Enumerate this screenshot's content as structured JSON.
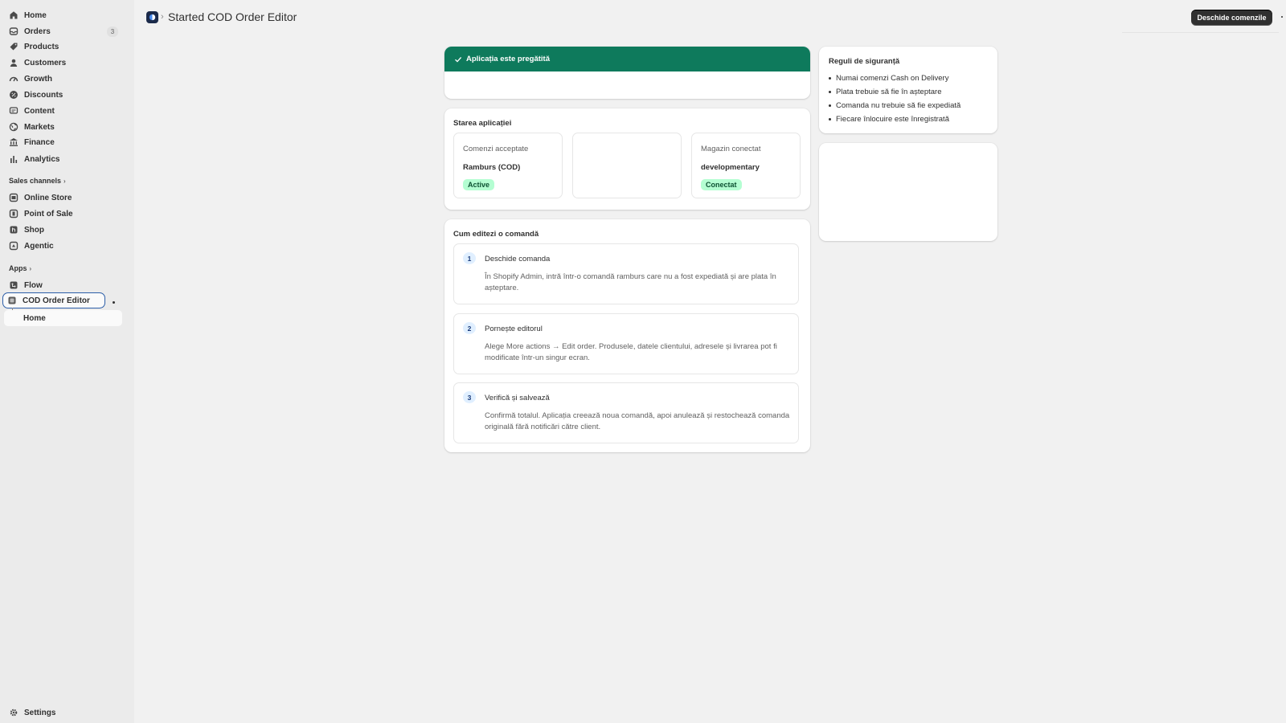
{
  "sidebar": {
    "items": [
      {
        "label": "Home",
        "icon": "home-icon"
      },
      {
        "label": "Orders",
        "icon": "inbox-icon",
        "count": "3"
      },
      {
        "label": "Products",
        "icon": "tag-icon"
      },
      {
        "label": "Customers",
        "icon": "person-icon"
      },
      {
        "label": "Growth",
        "icon": "gauge-icon"
      },
      {
        "label": "Discounts",
        "icon": "discount-icon"
      },
      {
        "label": "Content",
        "icon": "content-icon"
      },
      {
        "label": "Markets",
        "icon": "globe-icon"
      },
      {
        "label": "Finance",
        "icon": "bank-icon"
      },
      {
        "label": "Analytics",
        "icon": "bar-chart-icon"
      }
    ],
    "sales_channels_label": "Sales channels",
    "channels": [
      {
        "label": "Online Store",
        "icon": "store-icon"
      },
      {
        "label": "Point of Sale",
        "icon": "pos-icon"
      },
      {
        "label": "Shop",
        "icon": "shop-icon"
      },
      {
        "label": "Agentic",
        "icon": "agentic-icon"
      }
    ],
    "apps_label": "Apps",
    "apps": [
      {
        "label": "Flow",
        "icon": "flow-icon"
      },
      {
        "label": "COD Order Editor",
        "icon": "app-icon"
      }
    ],
    "sub_home": "Home",
    "settings": "Settings"
  },
  "header": {
    "title": "Started COD Order Editor",
    "primary_button": "Deschide comenzile"
  },
  "banner": {
    "text": "Aplicația este pregătită",
    "color": "#0e7a5c"
  },
  "status": {
    "title": "Starea aplicației",
    "boxes": [
      {
        "label": "Comenzi acceptate",
        "value": "Ramburs (COD)",
        "badge": "Active"
      },
      {
        "label": "Magazin conectat",
        "value": "developmentary",
        "badge": "Conectat"
      }
    ]
  },
  "howto": {
    "title": "Cum editezi o comandă",
    "steps": [
      {
        "num": "1",
        "title": "Deschide comanda",
        "desc": "În Shopify Admin, intră într-o comandă ramburs care nu a fost expediată și are plata în așteptare."
      },
      {
        "num": "2",
        "title": "Pornește editorul",
        "desc": "Alege More actions → Edit order. Produsele, datele clientului, adresele și livrarea pot fi modificate într-un singur ecran."
      },
      {
        "num": "3",
        "title": "Verifică și salvează",
        "desc": "Confirmă totalul. Aplicația creează noua comandă, apoi anulează și restochează comanda originală fără notificări către client."
      }
    ]
  },
  "rules": {
    "title": "Reguli de siguranță",
    "items": [
      "Numai comenzi Cash on Delivery",
      "Plata trebuie să fie în așteptare",
      "Comanda nu trebuie să fie expediată",
      "Fiecare înlocuire este înregistrată"
    ]
  }
}
